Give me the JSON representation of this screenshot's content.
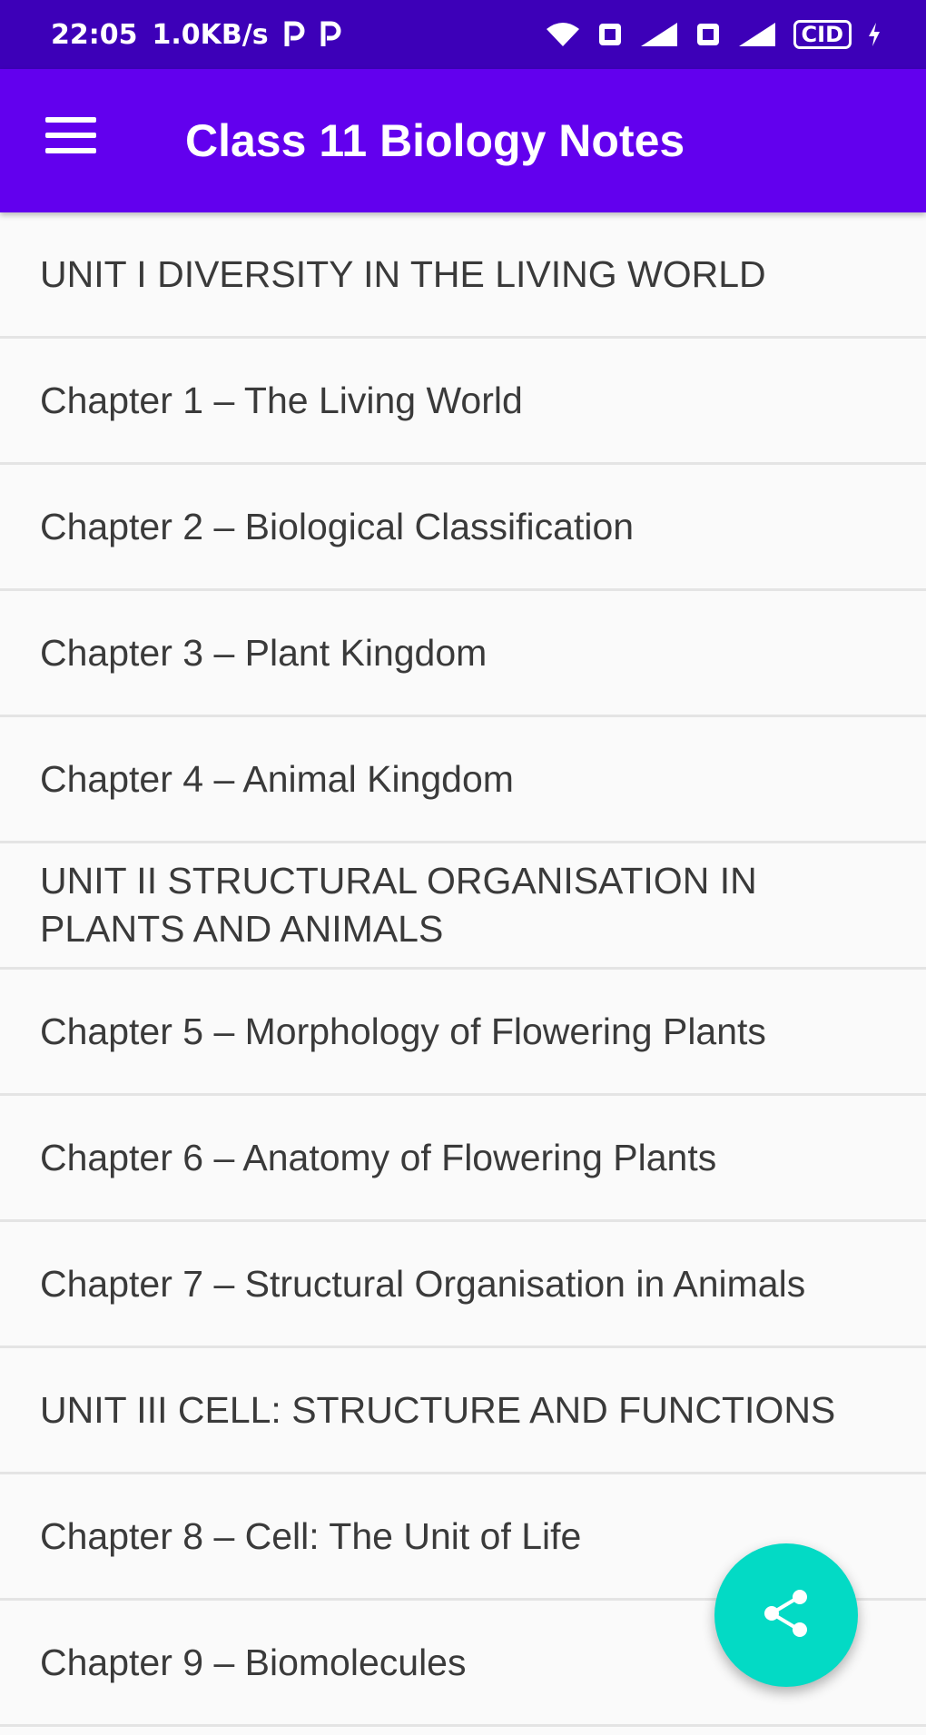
{
  "status_bar": {
    "time": "22:05",
    "network_speed": "1.0KB/s",
    "notification_icons": [
      "p-icon",
      "p-icon"
    ],
    "right_icons": [
      "wifi-icon",
      "volte-icon",
      "signal-icon",
      "volte-icon",
      "signal-icon"
    ],
    "battery": "CID"
  },
  "app_bar": {
    "title": "Class 11 Biology Notes",
    "menu_icon": "hamburger-menu-icon",
    "background": "#6200ee"
  },
  "list": {
    "items": [
      {
        "label": "UNIT I DIVERSITY IN THE LIVING WORLD"
      },
      {
        "label": "Chapter 1 – The Living World"
      },
      {
        "label": "Chapter 2 – Biological Classification"
      },
      {
        "label": "Chapter 3 – Plant Kingdom"
      },
      {
        "label": "Chapter 4 – Animal Kingdom"
      },
      {
        "label": "UNIT II STRUCTURAL ORGANISATION IN PLANTS AND ANIMALS"
      },
      {
        "label": "Chapter 5 – Morphology of Flowering Plants"
      },
      {
        "label": "Chapter 6 – Anatomy of Flowering Plants"
      },
      {
        "label": "Chapter 7 – Structural Organisation in Animals"
      },
      {
        "label": "UNIT III CELL: STRUCTURE AND FUNCTIONS"
      },
      {
        "label": "Chapter 8 – Cell: The Unit of Life"
      },
      {
        "label": "Chapter 9 – Biomolecules"
      }
    ]
  },
  "fab": {
    "icon": "share-icon",
    "color": "#03dac5"
  },
  "colors": {
    "status_bar": "#3d00b8",
    "accent": "#6200ee"
  }
}
